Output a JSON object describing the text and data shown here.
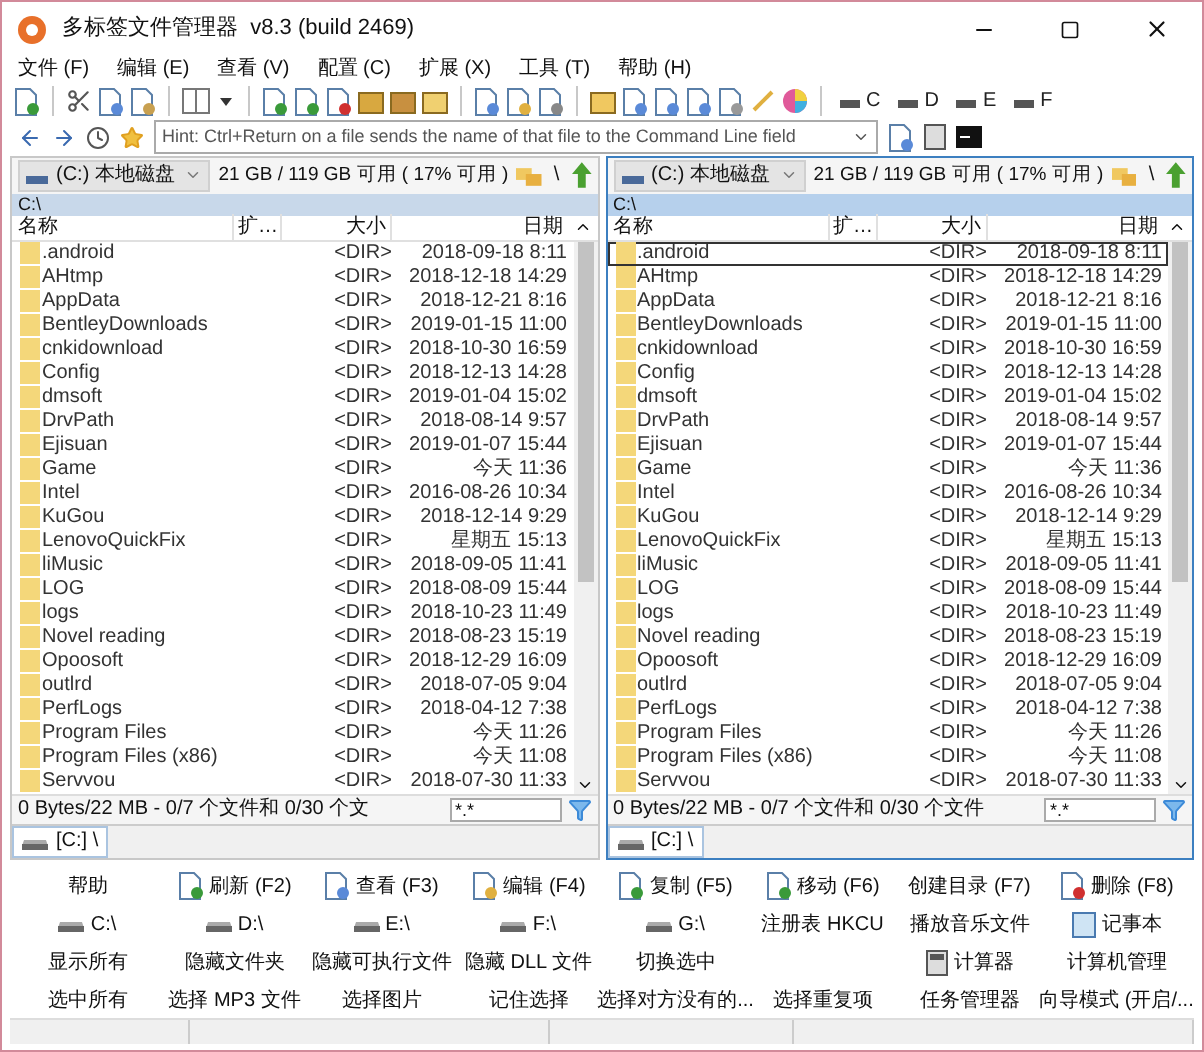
{
  "window": {
    "title": "多标签文件管理器  v8.3 (build 2469)"
  },
  "menu": [
    {
      "label": "文件 (F)"
    },
    {
      "label": "编辑 (E)"
    },
    {
      "label": "查看 (V)"
    },
    {
      "label": "配置 (C)"
    },
    {
      "label": "扩展 (X)"
    },
    {
      "label": "工具 (T)"
    },
    {
      "label": "帮助 (H)"
    }
  ],
  "toolbar": {
    "drives": [
      "C",
      "D",
      "E",
      "F"
    ]
  },
  "command_line": {
    "placeholder": "Hint: Ctrl+Return on a file sends the name of that file to the Command Line field"
  },
  "panels": [
    {
      "active": false,
      "drive": "(C:) 本地磁盘",
      "space": "21 GB / 119 GB 可用 ( 17% 可用 )",
      "up_label": "\\",
      "path": "C:\\",
      "columns": [
        "名称",
        "扩…",
        "大小",
        "日期"
      ],
      "files": [
        {
          "name": ".android",
          "size": "<DIR>",
          "date": "2018-09-18 8:11",
          "focused": false
        },
        {
          "name": "AHtmp",
          "size": "<DIR>",
          "date": "2018-12-18 14:29",
          "focused": false
        },
        {
          "name": "AppData",
          "size": "<DIR>",
          "date": "2018-12-21 8:16",
          "focused": false
        },
        {
          "name": "BentleyDownloads",
          "size": "<DIR>",
          "date": "2019-01-15 11:00",
          "focused": false
        },
        {
          "name": "cnkidownload",
          "size": "<DIR>",
          "date": "2018-10-30 16:59",
          "focused": false
        },
        {
          "name": "Config",
          "size": "<DIR>",
          "date": "2018-12-13 14:28",
          "focused": false
        },
        {
          "name": "dmsoft",
          "size": "<DIR>",
          "date": "2019-01-04 15:02",
          "focused": false
        },
        {
          "name": "DrvPath",
          "size": "<DIR>",
          "date": "2018-08-14 9:57",
          "focused": false
        },
        {
          "name": "Ejisuan",
          "size": "<DIR>",
          "date": "2019-01-07 15:44",
          "focused": false
        },
        {
          "name": "Game",
          "size": "<DIR>",
          "date": "今天 11:36",
          "focused": false
        },
        {
          "name": "Intel",
          "size": "<DIR>",
          "date": "2016-08-26 10:34",
          "focused": false
        },
        {
          "name": "KuGou",
          "size": "<DIR>",
          "date": "2018-12-14 9:29",
          "focused": false
        },
        {
          "name": "LenovoQuickFix",
          "size": "<DIR>",
          "date": "星期五 15:13",
          "focused": false
        },
        {
          "name": "liMusic",
          "size": "<DIR>",
          "date": "2018-09-05 11:41",
          "focused": false
        },
        {
          "name": "LOG",
          "size": "<DIR>",
          "date": "2018-08-09 15:44",
          "focused": false
        },
        {
          "name": "logs",
          "size": "<DIR>",
          "date": "2018-10-23 11:49",
          "focused": false
        },
        {
          "name": "Novel reading",
          "size": "<DIR>",
          "date": "2018-08-23 15:19",
          "focused": false
        },
        {
          "name": "Opoosoft",
          "size": "<DIR>",
          "date": "2018-12-29 16:09",
          "focused": false
        },
        {
          "name": "outlrd",
          "size": "<DIR>",
          "date": "2018-07-05 9:04",
          "focused": false
        },
        {
          "name": "PerfLogs",
          "size": "<DIR>",
          "date": "2018-04-12 7:38",
          "focused": false
        },
        {
          "name": "Program Files",
          "size": "<DIR>",
          "date": "今天 11:26",
          "focused": false
        },
        {
          "name": "Program Files (x86)",
          "size": "<DIR>",
          "date": "今天 11:08",
          "focused": false
        },
        {
          "name": "Servvou",
          "size": "<DIR>",
          "date": "2018-07-30 11:33",
          "focused": false
        }
      ],
      "status": "0 Bytes/22 MB - 0/7 个文件和 0/30 个文",
      "filter": "*.*",
      "tab": "[C:] \\"
    },
    {
      "active": true,
      "drive": "(C:) 本地磁盘",
      "space": "21 GB / 119 GB 可用 ( 17% 可用 )",
      "up_label": "\\",
      "path": "C:\\",
      "columns": [
        "名称",
        "扩…",
        "大小",
        "日期"
      ],
      "files": [
        {
          "name": ".android",
          "size": "<DIR>",
          "date": "2018-09-18 8:11",
          "focused": true
        },
        {
          "name": "AHtmp",
          "size": "<DIR>",
          "date": "2018-12-18 14:29",
          "focused": false
        },
        {
          "name": "AppData",
          "size": "<DIR>",
          "date": "2018-12-21 8:16",
          "focused": false
        },
        {
          "name": "BentleyDownloads",
          "size": "<DIR>",
          "date": "2019-01-15 11:00",
          "focused": false
        },
        {
          "name": "cnkidownload",
          "size": "<DIR>",
          "date": "2018-10-30 16:59",
          "focused": false
        },
        {
          "name": "Config",
          "size": "<DIR>",
          "date": "2018-12-13 14:28",
          "focused": false
        },
        {
          "name": "dmsoft",
          "size": "<DIR>",
          "date": "2019-01-04 15:02",
          "focused": false
        },
        {
          "name": "DrvPath",
          "size": "<DIR>",
          "date": "2018-08-14 9:57",
          "focused": false
        },
        {
          "name": "Ejisuan",
          "size": "<DIR>",
          "date": "2019-01-07 15:44",
          "focused": false
        },
        {
          "name": "Game",
          "size": "<DIR>",
          "date": "今天 11:36",
          "focused": false
        },
        {
          "name": "Intel",
          "size": "<DIR>",
          "date": "2016-08-26 10:34",
          "focused": false
        },
        {
          "name": "KuGou",
          "size": "<DIR>",
          "date": "2018-12-14 9:29",
          "focused": false
        },
        {
          "name": "LenovoQuickFix",
          "size": "<DIR>",
          "date": "星期五 15:13",
          "focused": false
        },
        {
          "name": "liMusic",
          "size": "<DIR>",
          "date": "2018-09-05 11:41",
          "focused": false
        },
        {
          "name": "LOG",
          "size": "<DIR>",
          "date": "2018-08-09 15:44",
          "focused": false
        },
        {
          "name": "logs",
          "size": "<DIR>",
          "date": "2018-10-23 11:49",
          "focused": false
        },
        {
          "name": "Novel reading",
          "size": "<DIR>",
          "date": "2018-08-23 15:19",
          "focused": false
        },
        {
          "name": "Opoosoft",
          "size": "<DIR>",
          "date": "2018-12-29 16:09",
          "focused": false
        },
        {
          "name": "outlrd",
          "size": "<DIR>",
          "date": "2018-07-05 9:04",
          "focused": false
        },
        {
          "name": "PerfLogs",
          "size": "<DIR>",
          "date": "2018-04-12 7:38",
          "focused": false
        },
        {
          "name": "Program Files",
          "size": "<DIR>",
          "date": "今天 11:26",
          "focused": false
        },
        {
          "name": "Program Files (x86)",
          "size": "<DIR>",
          "date": "今天 11:08",
          "focused": false
        },
        {
          "name": "Servvou",
          "size": "<DIR>",
          "date": "2018-07-30 11:33",
          "focused": false
        }
      ],
      "status": "0 Bytes/22 MB - 0/7 个文件和 0/30 个文件",
      "filter": "*.*",
      "tab": "[C:] \\"
    }
  ],
  "buttons": [
    {
      "label": "帮助",
      "kind": "text"
    },
    {
      "label": "刷新 (F2)",
      "kind": "refresh"
    },
    {
      "label": "查看 (F3)",
      "kind": "view"
    },
    {
      "label": "编辑 (F4)",
      "kind": "edit"
    },
    {
      "label": "复制 (F5)",
      "kind": "copy"
    },
    {
      "label": "移动 (F6)",
      "kind": "move"
    },
    {
      "label": "创建目录 (F7)",
      "kind": "text"
    },
    {
      "label": "删除 (F8)",
      "kind": "delete"
    },
    {
      "label": "C:\\",
      "kind": "drive"
    },
    {
      "label": "D:\\",
      "kind": "drive"
    },
    {
      "label": "E:\\",
      "kind": "drive"
    },
    {
      "label": "F:\\",
      "kind": "drive"
    },
    {
      "label": "G:\\",
      "kind": "drive"
    },
    {
      "label": "注册表 HKCU",
      "kind": "text"
    },
    {
      "label": "播放音乐文件",
      "kind": "text"
    },
    {
      "label": "记事本",
      "kind": "notepad"
    },
    {
      "label": "显示所有",
      "kind": "text"
    },
    {
      "label": "隐藏文件夹",
      "kind": "text"
    },
    {
      "label": "隐藏可执行文件",
      "kind": "text"
    },
    {
      "label": "隐藏 DLL 文件",
      "kind": "text"
    },
    {
      "label": "切换选中",
      "kind": "text"
    },
    {
      "kind": "empty"
    },
    {
      "label": "计算器",
      "kind": "calculator"
    },
    {
      "label": "计算机管理",
      "kind": "text"
    },
    {
      "label": "选中所有",
      "kind": "text"
    },
    {
      "label": "选择 MP3 文件",
      "kind": "text"
    },
    {
      "label": "选择图片",
      "kind": "text"
    },
    {
      "label": "记住选择",
      "kind": "text"
    },
    {
      "label": "选择对方没有的...",
      "kind": "text"
    },
    {
      "label": "选择重复项",
      "kind": "text"
    },
    {
      "label": "任务管理器",
      "kind": "text"
    },
    {
      "label": "向导模式 (开启/...",
      "kind": "text"
    }
  ]
}
